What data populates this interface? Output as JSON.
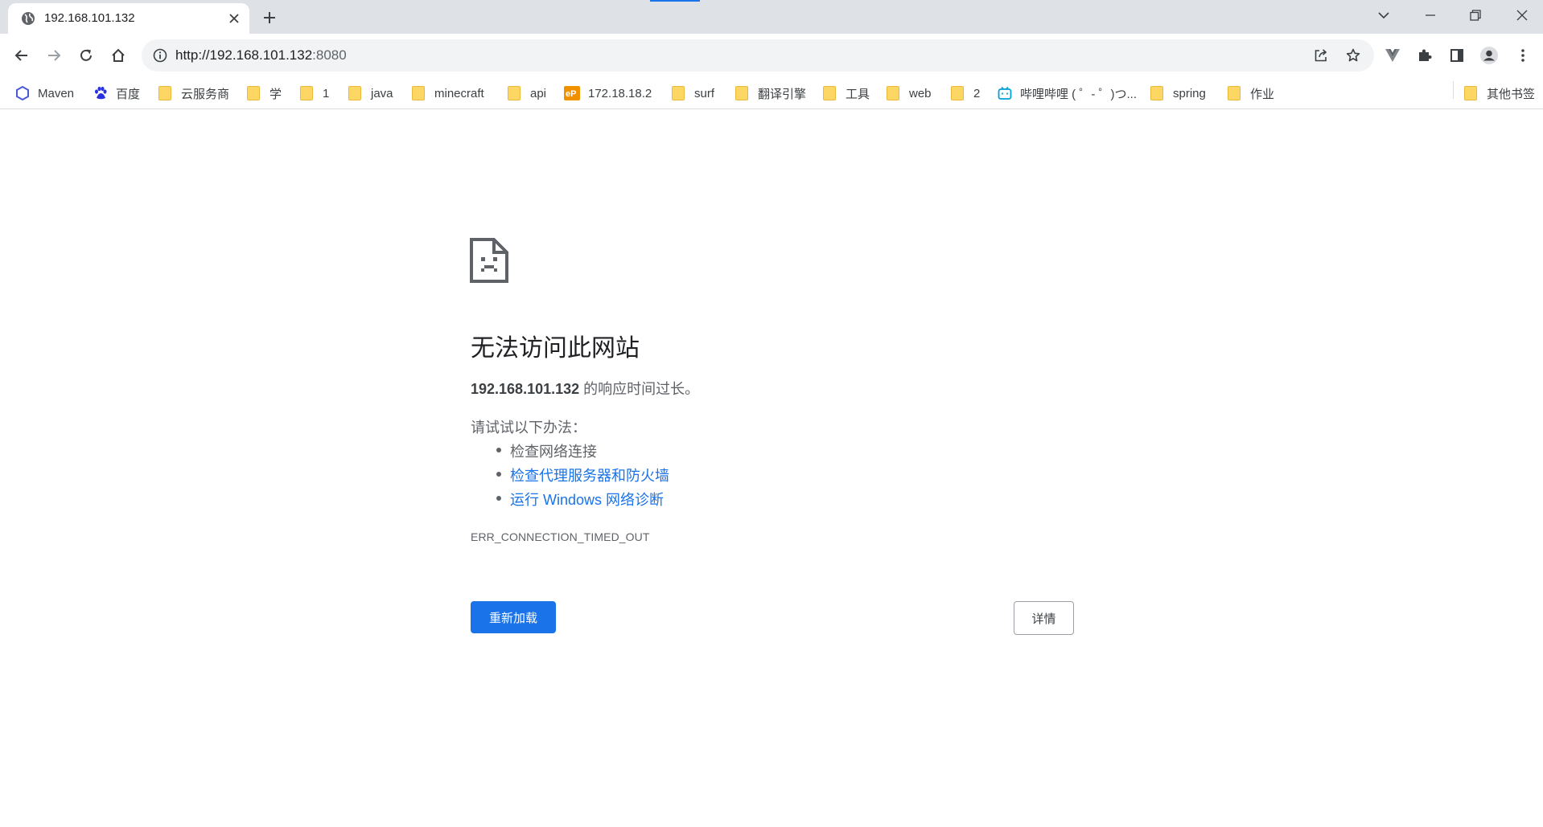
{
  "tab": {
    "title": "192.168.101.132",
    "favicon": "globe-icon"
  },
  "window": {
    "accent_color": "#1a73e8"
  },
  "address_bar": {
    "url_main": "http://192.168.101.132",
    "url_port": ":8080"
  },
  "bookmarks": [
    {
      "label": "Maven",
      "icon": "maven-icon"
    },
    {
      "label": "百度",
      "icon": "baidu-paw-icon"
    },
    {
      "label": "云服务商",
      "icon": "folder-icon"
    },
    {
      "label": "学",
      "icon": "folder-icon"
    },
    {
      "label": "1",
      "icon": "folder-icon"
    },
    {
      "label": "java",
      "icon": "folder-icon"
    },
    {
      "label": "minecraft",
      "icon": "folder-icon"
    },
    {
      "label": "api",
      "icon": "folder-icon"
    },
    {
      "label": "172.18.18.2",
      "icon": "ep-icon"
    },
    {
      "label": "surf",
      "icon": "folder-icon"
    },
    {
      "label": "翻译引擎",
      "icon": "folder-icon"
    },
    {
      "label": "工具",
      "icon": "folder-icon"
    },
    {
      "label": "web",
      "icon": "folder-icon"
    },
    {
      "label": "2",
      "icon": "folder-icon"
    },
    {
      "label": "哔哩哔哩 ( ゜- ゜)つ...",
      "icon": "bilibili-icon"
    },
    {
      "label": "spring",
      "icon": "folder-icon"
    },
    {
      "label": "作业",
      "icon": "folder-icon"
    }
  ],
  "other_bookmarks": {
    "label": "其他书签",
    "icon": "folder-icon"
  },
  "error": {
    "title": "无法访问此网站",
    "host": "192.168.101.132",
    "message_suffix": " 的响应时间过长。",
    "try_label": "请试试以下办法：",
    "suggestions": [
      {
        "text": "检查网络连接",
        "link": false
      },
      {
        "text": "检查代理服务器和防火墙",
        "link": true
      },
      {
        "text": "运行 Windows 网络诊断",
        "link": true
      }
    ],
    "code": "ERR_CONNECTION_TIMED_OUT",
    "reload_label": "重新加载",
    "details_label": "详情"
  }
}
